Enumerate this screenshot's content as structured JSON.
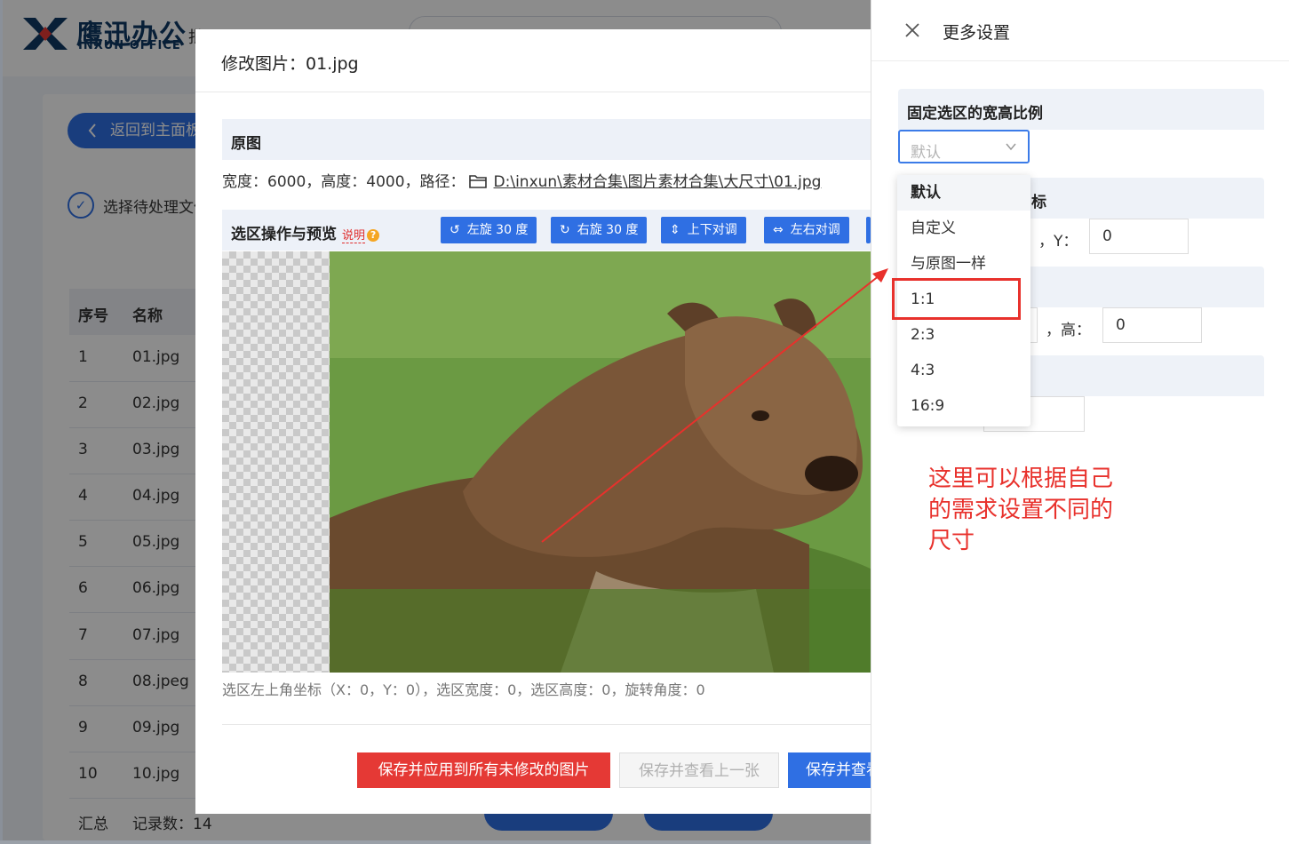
{
  "app": {
    "logo_cn": "鹰迅办公",
    "logo_en": "INXUN OFFICE",
    "nav_first": "批",
    "back_button": "返回到主面板",
    "step_label": "选择待处理文件",
    "table": {
      "headers": [
        "序号",
        "名称"
      ],
      "rows": [
        [
          "1",
          "01.jpg"
        ],
        [
          "2",
          "02.jpg"
        ],
        [
          "3",
          "03.jpg"
        ],
        [
          "4",
          "04.jpg"
        ],
        [
          "5",
          "05.jpg"
        ],
        [
          "6",
          "06.jpg"
        ],
        [
          "7",
          "07.jpg"
        ],
        [
          "8",
          "08.jpeg"
        ],
        [
          "9",
          "09.jpg"
        ],
        [
          "10",
          "10.jpg"
        ]
      ],
      "summary_label": "汇总",
      "summary_count": "记录数：14"
    }
  },
  "dialog": {
    "title": "修改图片：01.jpg",
    "original_section": "原图",
    "info_prefix": "宽度：6000，高度：4000，路径：",
    "path": "D:\\inxun\\素材合集\\图片素材合集\\大尺寸\\01.jpg",
    "preview_section": "选区操作与预览",
    "help_text": "说明",
    "toolbar": {
      "rotate_left": "左旋 30 度",
      "rotate_right": "右旋 30 度",
      "flip_vertical": "上下对调",
      "flip_horizontal": "左右对调"
    },
    "selection_info": "选区左上角坐标（X：0，Y：0），选区宽度：0，选区高度：0，旋转角度：0",
    "buttons": {
      "save_apply_all": "保存并应用到所有未修改的图片",
      "save_prev": "保存并查看上一张",
      "save_next": "保存并查看下一张"
    }
  },
  "drawer": {
    "title": "更多设置",
    "aspect_section": "固定选区的宽高比例",
    "aspect_value": "默认",
    "coord_section_tail": "标",
    "y_label": "，Y：",
    "y_value": "0",
    "height_label": "，高：",
    "height_value": "0",
    "dropdown_options": [
      "默认",
      "自定义",
      "与原图一样",
      "1:1",
      "2:3",
      "4:3",
      "16:9"
    ],
    "selected_option": "默认"
  },
  "annotation": {
    "note": "这里可以根据自己的需求设置不同的尺寸",
    "color": "#e8312c"
  }
}
